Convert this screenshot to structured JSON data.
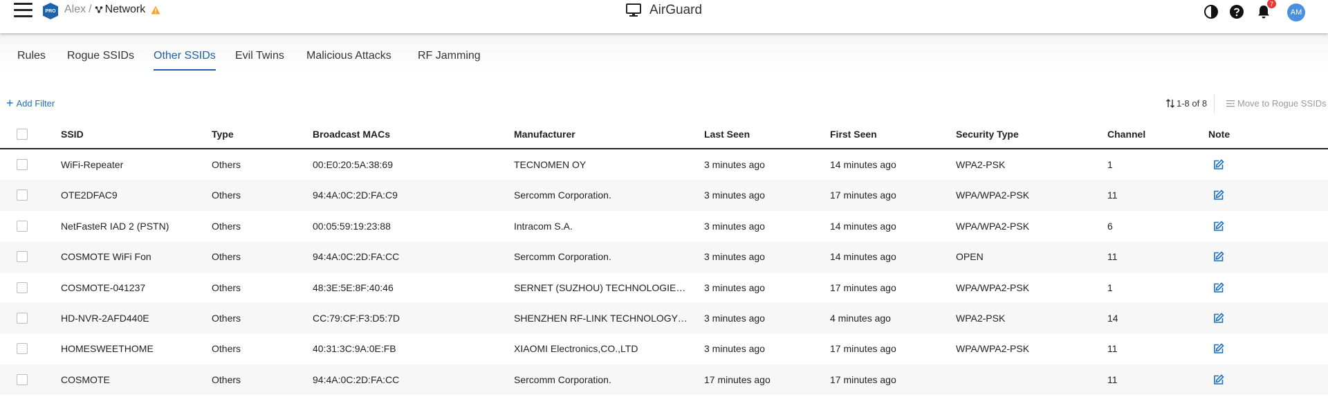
{
  "header": {
    "breadcrumb_parent": "Alex",
    "breadcrumb_sep": "/",
    "breadcrumb_current": "Network",
    "pro_badge": "PRO",
    "app_title": "AirGuard",
    "notification_count": "7",
    "avatar_initials": "AM"
  },
  "tabs": [
    {
      "label": "Rules"
    },
    {
      "label": "Rogue SSIDs"
    },
    {
      "label": "Other SSIDs",
      "active": true
    },
    {
      "label": "Evil Twins"
    },
    {
      "label": "Malicious Attacks"
    },
    {
      "label": "RF Jamming"
    }
  ],
  "toolbar": {
    "add_filter_label": "Add Filter",
    "record_count": "1-8 of 8",
    "move_label": "Move to Rogue SSIDs"
  },
  "table": {
    "columns": [
      "SSID",
      "Type",
      "Broadcast MACs",
      "Manufacturer",
      "Last Seen",
      "First Seen",
      "Security Type",
      "Channel",
      "Note"
    ],
    "rows": [
      {
        "ssid": "WiFi-Repeater",
        "type": "Others",
        "mac": "00:E0:20:5A:38:69",
        "manufacturer": "TECNOMEN OY",
        "last_seen": "3 minutes ago",
        "first_seen": "14 minutes ago",
        "security": "WPA2-PSK",
        "channel": "1"
      },
      {
        "ssid": "OTE2DFAC9",
        "type": "Others",
        "mac": "94:4A:0C:2D:FA:C9",
        "manufacturer": "Sercomm Corporation.",
        "last_seen": "3 minutes ago",
        "first_seen": "17 minutes ago",
        "security": "WPA/WPA2-PSK",
        "channel": "11"
      },
      {
        "ssid": "NetFasteR IAD 2 (PSTN)",
        "type": "Others",
        "mac": "00:05:59:19:23:88",
        "manufacturer": "Intracom S.A.",
        "last_seen": "3 minutes ago",
        "first_seen": "14 minutes ago",
        "security": "WPA/WPA2-PSK",
        "channel": "6"
      },
      {
        "ssid": "COSMOTE WiFi Fon",
        "type": "Others",
        "mac": "94:4A:0C:2D:FA:CC",
        "manufacturer": "Sercomm Corporation.",
        "last_seen": "3 minutes ago",
        "first_seen": "14 minutes ago",
        "security": "OPEN",
        "channel": "11"
      },
      {
        "ssid": "COSMOTE-041237",
        "type": "Others",
        "mac": "48:3E:5E:8F:40:46",
        "manufacturer": "SERNET (SUZHOU) TECHNOLOGIES …",
        "last_seen": "3 minutes ago",
        "first_seen": "17 minutes ago",
        "security": "WPA/WPA2-PSK",
        "channel": "1"
      },
      {
        "ssid": "HD-NVR-2AFD440E",
        "type": "Others",
        "mac": "CC:79:CF:F3:D5:7D",
        "manufacturer": "SHENZHEN RF-LINK TECHNOLOGY …",
        "last_seen": "3 minutes ago",
        "first_seen": "4 minutes ago",
        "security": "WPA2-PSK",
        "channel": "14"
      },
      {
        "ssid": "HOMESWEETHOME",
        "type": "Others",
        "mac": "40:31:3C:9A:0E:FB",
        "manufacturer": "XIAOMI Electronics,CO.,LTD",
        "last_seen": "3 minutes ago",
        "first_seen": "17 minutes ago",
        "security": "WPA/WPA2-PSK",
        "channel": "11"
      },
      {
        "ssid": "COSMOTE",
        "type": "Others",
        "mac": "94:4A:0C:2D:FA:CC",
        "manufacturer": "Sercomm Corporation.",
        "last_seen": "17 minutes ago",
        "first_seen": "17 minutes ago",
        "security": "",
        "channel": "11"
      }
    ]
  },
  "colors": {
    "accent": "#1a5fa8",
    "link": "#1a6fc0",
    "warning": "#f5a623",
    "badge": "#e53935",
    "avatar": "#4a8fe0"
  }
}
